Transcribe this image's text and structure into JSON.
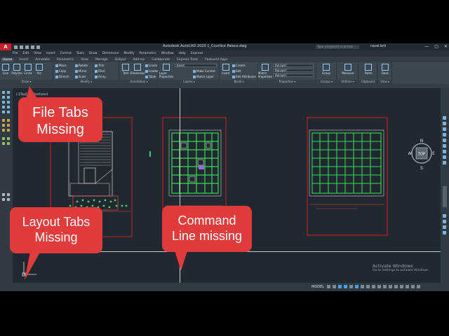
{
  "app": {
    "logo": "A",
    "title": "Autodesk AutoCAD 2020   1_Courtice Palace.dwg",
    "search_placeholder": "Type a keyword or phrase",
    "user": "raval.brh",
    "window_controls": [
      "—",
      "□",
      "✕"
    ]
  },
  "menubar": {
    "items": [
      "File",
      "Edit",
      "View",
      "Insert",
      "Format",
      "Tools",
      "Draw",
      "Dimension",
      "Modify",
      "Parametric",
      "Window",
      "Help",
      "Express"
    ]
  },
  "ribbon_tabs": {
    "items": [
      "Home",
      "Insert",
      "Annotate",
      "Parametric",
      "View",
      "Manage",
      "Output",
      "Add-ins",
      "Collaborate",
      "Express Tools",
      "Featured Apps"
    ],
    "active": "Home"
  },
  "ribbon": {
    "draw": {
      "label": "Draw ▾",
      "tools": [
        "Line",
        "Polyline",
        "Circle",
        "Arc"
      ]
    },
    "modify": {
      "label": "Modify ▾",
      "tools": [
        "Move",
        "Rotate",
        "Trim",
        "Copy",
        "Mirror",
        "Fillet",
        "Stretch",
        "Scale",
        "Array"
      ]
    },
    "annotation": {
      "label": "Annotation ▾",
      "tools": [
        "Text",
        "Dimension",
        "Linear",
        "Leader",
        "Table"
      ]
    },
    "layers": {
      "label": "Layers ▾",
      "big_tool": "Layer Properties",
      "combo": "beam",
      "tools": [
        "Make Current",
        "Match Layer"
      ]
    },
    "block": {
      "label": "Block ▾",
      "big_tool": "Insert",
      "tools": [
        "Create",
        "Edit",
        "Edit Attributes"
      ]
    },
    "properties": {
      "label": "Properties ▾",
      "big_tool": "Match Properties",
      "combos": [
        "ByLayer",
        "ByLayer",
        "ByLayer"
      ]
    },
    "groups": {
      "label": "Groups ▾",
      "big_tool": "Group"
    },
    "utilities": {
      "label": "Utilities ▾",
      "big_tool": "Measure"
    },
    "clipboard": {
      "label": "Clipboard",
      "big_tool": "Paste"
    },
    "view": {
      "label": "View ▾",
      "big_tool": "Base"
    }
  },
  "viewport": {
    "label": "[-][Top][2D Wireframe]"
  },
  "navcube": {
    "north": "N",
    "south": "S",
    "east": "E",
    "west": "W",
    "face": "TOP"
  },
  "watermark": {
    "line1": "Activate Windows",
    "line2": "Go to Settings to activate Windows."
  },
  "statusbar": {
    "model": "MODEL"
  },
  "callouts": {
    "file_tabs": [
      "File Tabs",
      "Missing"
    ],
    "layout_tabs": [
      "Layout Tabs",
      "Missing"
    ],
    "command_line": [
      "Command",
      "Line missing"
    ]
  },
  "colors": {
    "callout": "#e23b3b",
    "sheet_border": "#cc2222",
    "plan_lines": "#33dd55",
    "canvas": "#212830"
  }
}
